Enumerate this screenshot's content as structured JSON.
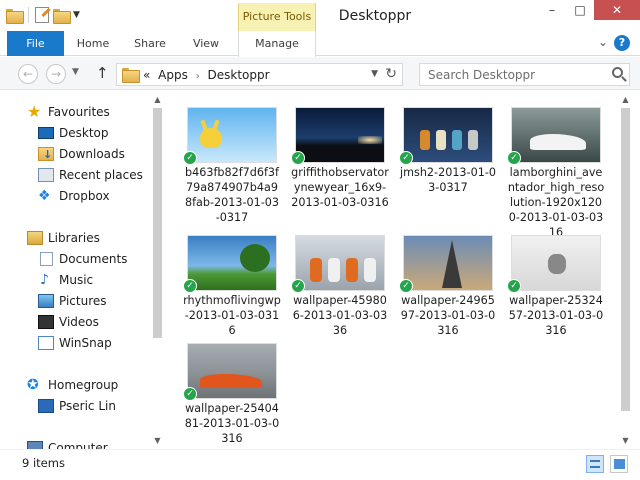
{
  "window": {
    "title": "Desktoppr",
    "contextual_tab_group": "Picture Tools",
    "controls": {
      "minimize": "–",
      "maximize": "□",
      "close": "✕"
    }
  },
  "ribbon": {
    "tabs": [
      "File",
      "Home",
      "Share",
      "View",
      "Manage"
    ],
    "help": "?"
  },
  "address": {
    "prefix": "«",
    "crumbs": [
      "Apps",
      "Desktoppr"
    ],
    "separator": "›",
    "search_placeholder": "Search Desktoppr"
  },
  "nav": {
    "favourites": {
      "header": "Favourites",
      "items": [
        "Desktop",
        "Downloads",
        "Recent places",
        "Dropbox"
      ]
    },
    "libraries": {
      "header": "Libraries",
      "items": [
        "Documents",
        "Music",
        "Pictures",
        "Videos",
        "WinSnap"
      ]
    },
    "homegroup": {
      "header": "Homegroup",
      "items": [
        "Pseric Lin"
      ]
    },
    "computer": "Computer"
  },
  "files": [
    {
      "name": "b463fb82f7d6f3f79a874907b4a98fab-2013-01-03-0317",
      "sync": "synced"
    },
    {
      "name": "griffithobservatorynewyear_16x9-2013-01-03-0316",
      "sync": "synced"
    },
    {
      "name": "jmsh2-2013-01-03-0317",
      "sync": "synced"
    },
    {
      "name": "lamborghini_aventador_high_resolution-1920x1200-2013-01-03-0316",
      "sync": "synced"
    },
    {
      "name": "rhythmoflivingwp-2013-01-03-0316",
      "sync": "synced"
    },
    {
      "name": "wallpaper-459806-2013-01-03-0336",
      "sync": "synced"
    },
    {
      "name": "wallpaper-2496597-2013-01-03-0316",
      "sync": "synced"
    },
    {
      "name": "wallpaper-2532457-2013-01-03-0316",
      "sync": "synced"
    },
    {
      "name": "wallpaper-2540481-2013-01-03-0316",
      "sync": "synced"
    }
  ],
  "status": {
    "item_count": "9 items",
    "sync_glyph": "✓"
  },
  "colors": {
    "accent": "#1979ca",
    "contextual_tab": "#f7f1b4",
    "sync_check": "#25a54b"
  }
}
